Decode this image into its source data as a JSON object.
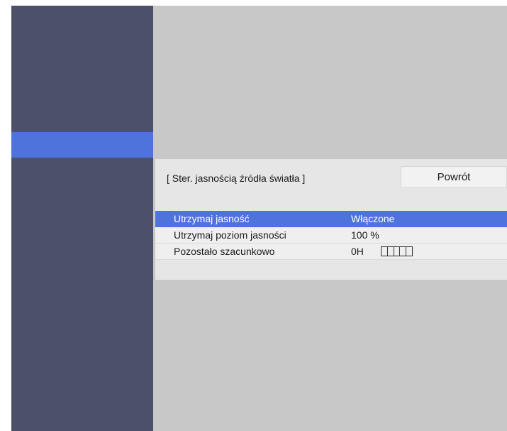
{
  "sidebar": {
    "selected_index": 5
  },
  "submenu": {
    "title": "[ Ster. jasnością źródła światła ]",
    "back_label": "Powrót",
    "rows": [
      {
        "label": "Utrzymaj jasność",
        "value": "Włączone",
        "selected": true
      },
      {
        "label": "Utrzymaj poziom jasności",
        "value": "100 %",
        "selected": false
      },
      {
        "label": "Pozostało szacunkowo",
        "value": "0H",
        "selected": false
      }
    ],
    "remaining_bar": {
      "segments": 5
    }
  },
  "colors": {
    "sidebar": "#4d5069",
    "highlight": "#4f73dc",
    "background": "#c8c8c8"
  }
}
